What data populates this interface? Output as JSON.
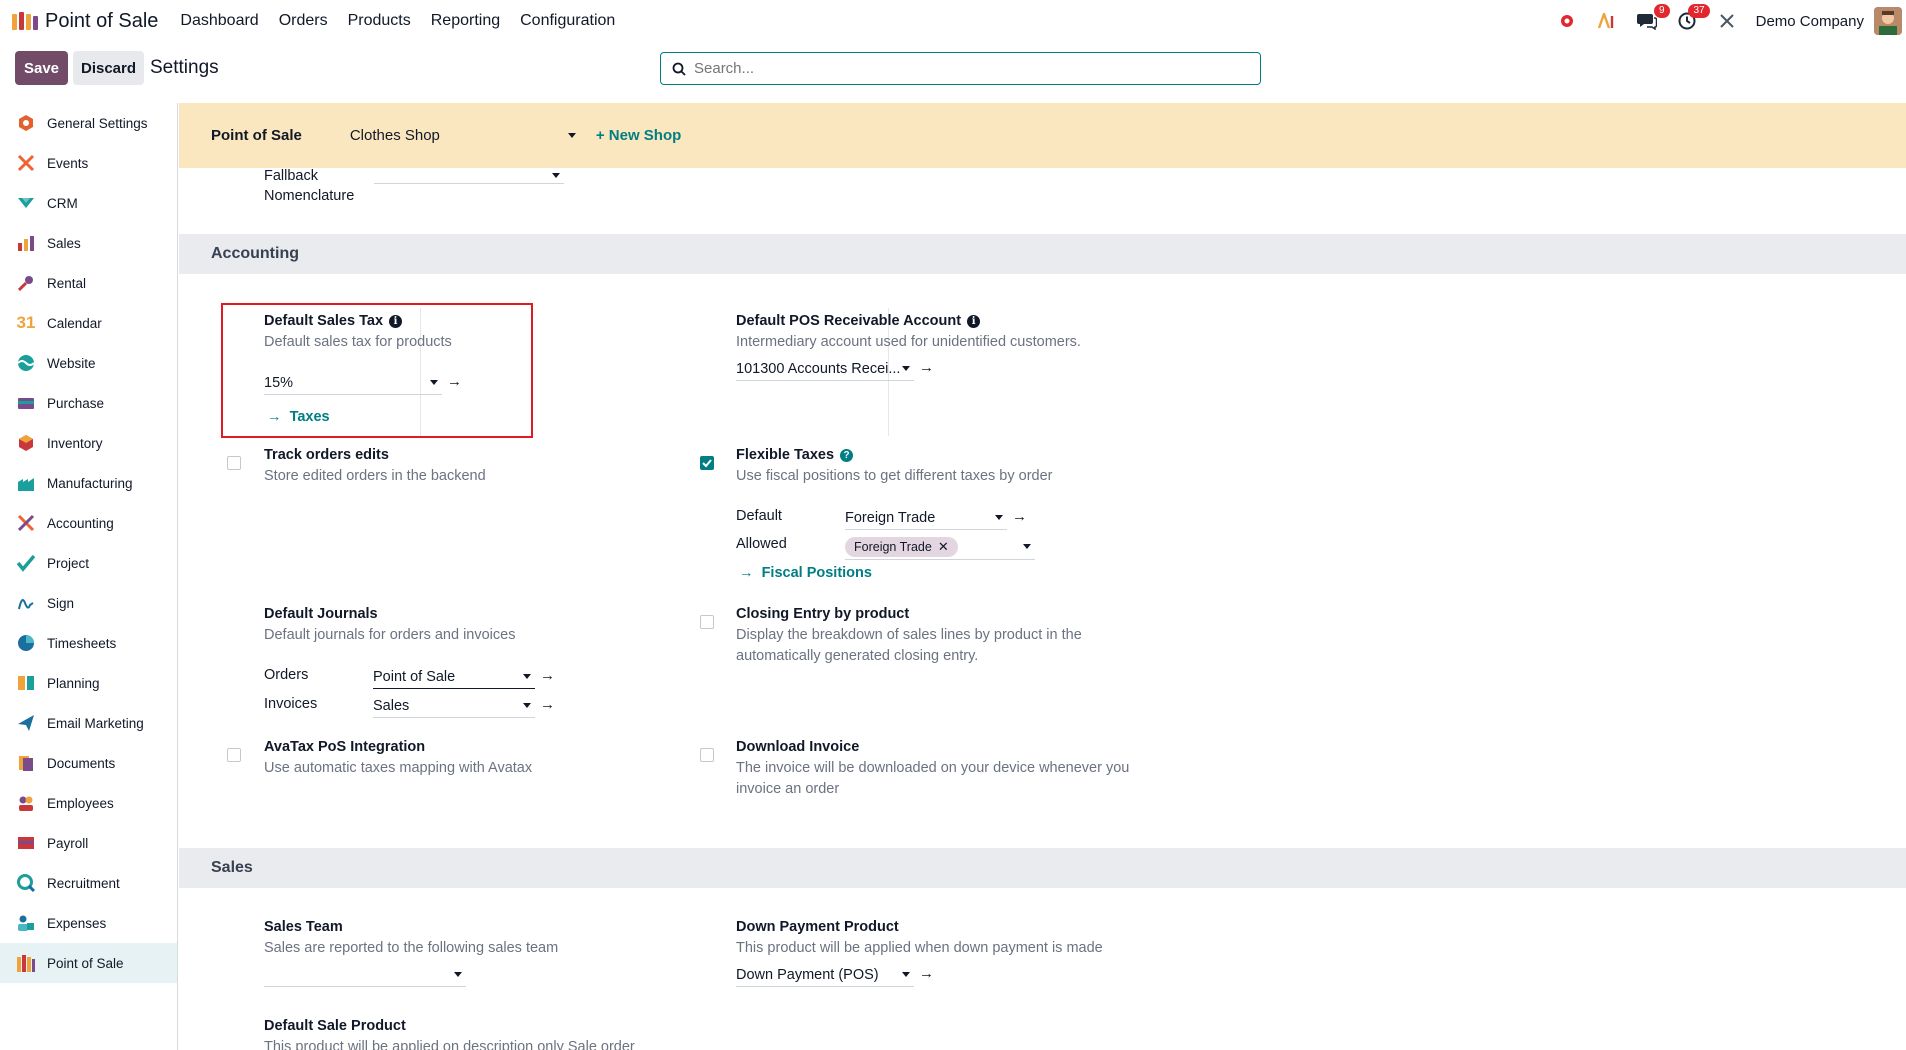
{
  "topbar": {
    "app_title": "Point of Sale",
    "menu": [
      "Dashboard",
      "Orders",
      "Products",
      "Reporting",
      "Configuration"
    ],
    "chat_badge": "9",
    "activity_badge": "37",
    "company": "Demo Company"
  },
  "control": {
    "save_label": "Save",
    "discard_label": "Discard",
    "title": "Settings",
    "search_placeholder": "Search..."
  },
  "sidebar": {
    "items": [
      {
        "label": "General Settings",
        "icon": "general-settings-icon"
      },
      {
        "label": "Events",
        "icon": "events-icon"
      },
      {
        "label": "CRM",
        "icon": "crm-icon"
      },
      {
        "label": "Sales",
        "icon": "sales-icon"
      },
      {
        "label": "Rental",
        "icon": "rental-icon"
      },
      {
        "label": "Calendar",
        "icon": "calendar-icon"
      },
      {
        "label": "Website",
        "icon": "website-icon"
      },
      {
        "label": "Purchase",
        "icon": "purchase-icon"
      },
      {
        "label": "Inventory",
        "icon": "inventory-icon"
      },
      {
        "label": "Manufacturing",
        "icon": "manufacturing-icon"
      },
      {
        "label": "Accounting",
        "icon": "accounting-icon"
      },
      {
        "label": "Project",
        "icon": "project-icon"
      },
      {
        "label": "Sign",
        "icon": "sign-icon"
      },
      {
        "label": "Timesheets",
        "icon": "timesheets-icon"
      },
      {
        "label": "Planning",
        "icon": "planning-icon"
      },
      {
        "label": "Email Marketing",
        "icon": "email-marketing-icon"
      },
      {
        "label": "Documents",
        "icon": "documents-icon"
      },
      {
        "label": "Employees",
        "icon": "employees-icon"
      },
      {
        "label": "Payroll",
        "icon": "payroll-icon"
      },
      {
        "label": "Recruitment",
        "icon": "recruitment-icon"
      },
      {
        "label": "Expenses",
        "icon": "expenses-icon"
      },
      {
        "label": "Point of Sale",
        "icon": "point-of-sale-icon",
        "active": true
      }
    ]
  },
  "shopbar": {
    "label": "Point of Sale",
    "shop": "Clothes Shop",
    "new_shop": "+ New Shop"
  },
  "fallback": {
    "label_line1": "Fallback",
    "label_line2": "Nomenclature"
  },
  "accounting": {
    "header": "Accounting",
    "default_sales_tax": {
      "title": "Default Sales Tax",
      "desc": "Default sales tax for products",
      "value": "15%",
      "link": "Taxes"
    },
    "receivable": {
      "title": "Default POS Receivable Account",
      "desc": "Intermediary account used for unidentified customers.",
      "value": "101300 Accounts Recei..."
    },
    "track_edits": {
      "title": "Track orders edits",
      "desc": "Store edited orders in the backend",
      "checked": false
    },
    "flexible_taxes": {
      "title": "Flexible Taxes",
      "desc": "Use fiscal positions to get different taxes by order",
      "checked": true,
      "default_label": "Default",
      "default_value": "Foreign Trade",
      "allowed_label": "Allowed",
      "allowed_tag": "Foreign Trade",
      "link": "Fiscal Positions"
    },
    "journals": {
      "title": "Default Journals",
      "desc": "Default journals for orders and invoices",
      "orders_label": "Orders",
      "orders_value": "Point of Sale",
      "invoices_label": "Invoices",
      "invoices_value": "Sales"
    },
    "closing_entry": {
      "title": "Closing Entry by product",
      "desc_line1": "Display the breakdown of sales lines by product in the",
      "desc_line2": "automatically generated closing entry.",
      "checked": false
    },
    "avatax": {
      "title": "AvaTax PoS Integration",
      "desc": "Use automatic taxes mapping with Avatax",
      "checked": false
    },
    "download_invoice": {
      "title": "Download Invoice",
      "desc_line1": "The invoice will be downloaded on your device whenever you",
      "desc_line2": "invoice an order",
      "checked": false
    }
  },
  "sales": {
    "header": "Sales",
    "sales_team": {
      "title": "Sales Team",
      "desc": "Sales are reported to the following sales team",
      "value": ""
    },
    "down_payment": {
      "title": "Down Payment Product",
      "desc": "This product will be applied when down payment is made",
      "value": "Down Payment (POS)"
    },
    "default_sale_product": {
      "title": "Default Sale Product",
      "desc": "This product will be applied on description only Sale order"
    }
  },
  "colors": {
    "brand": "#714b67",
    "accent": "#017e84",
    "shopbar": "#fbe7bf",
    "highlight": "#e01b24"
  }
}
